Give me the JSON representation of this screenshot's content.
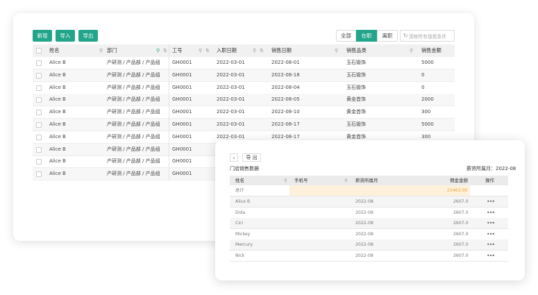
{
  "toolbar": {
    "add_label": "新增",
    "import_label": "导入",
    "export_label": "导出",
    "filter_all": "全部",
    "filter_active": "在职",
    "filter_left": "离职",
    "clear_search": "清除所有搜索条件"
  },
  "table": {
    "columns": [
      "姓名",
      "部门",
      "工号",
      "入职日期",
      "销售日期",
      "销售品类",
      "销售金额"
    ],
    "rows": [
      {
        "name": "Alice B",
        "dept": "产研测 / 产品部 / 产品组",
        "id": "GH0001",
        "join": "2022-03-01",
        "sale_date": "2022-08-01",
        "category": "玉石锻饰",
        "amount": "5000"
      },
      {
        "name": "Alice B",
        "dept": "产研测 / 产品部 / 产品组",
        "id": "GH0001",
        "join": "2022-03-01",
        "sale_date": "2022-08-18",
        "category": "玉石锻饰",
        "amount": "0"
      },
      {
        "name": "Alice B",
        "dept": "产研测 / 产品部 / 产品组",
        "id": "GH0001",
        "join": "2022-03-01",
        "sale_date": "2022-08-04",
        "category": "玉石锻饰",
        "amount": "0"
      },
      {
        "name": "Alice B",
        "dept": "产研测 / 产品部 / 产品组",
        "id": "GH0001",
        "join": "2022-03-01",
        "sale_date": "2022-08-05",
        "category": "黄金首饰",
        "amount": "2000"
      },
      {
        "name": "Alice B",
        "dept": "产研测 / 产品部 / 产品组",
        "id": "GH0001",
        "join": "2022-03-01",
        "sale_date": "2022-08-10",
        "category": "黄金首饰",
        "amount": "300"
      },
      {
        "name": "Alice B",
        "dept": "产研测 / 产品部 / 产品组",
        "id": "GH0001",
        "join": "2022-03-01",
        "sale_date": "2022-08-17",
        "category": "玉石锻饰",
        "amount": "5000"
      },
      {
        "name": "Alice B",
        "dept": "产研测 / 产品部 / 产品组",
        "id": "GH0001",
        "join": "2022-03-01",
        "sale_date": "2022-08-17",
        "category": "黄金首饰",
        "amount": "300"
      },
      {
        "name": "Alice B",
        "dept": "产研测 / 产品部 / 产品组",
        "id": "GH0001"
      },
      {
        "name": "Alice B",
        "dept": "产研测 / 产品部 / 产品组",
        "id": "GH0001"
      },
      {
        "name": "Alice B",
        "dept": "产研测 / 产品部 / 产品组",
        "id": "GH0001"
      }
    ]
  },
  "popup": {
    "export_label": "导 出",
    "title": "门店销售数据",
    "period": "薪资所属月：2022-08",
    "columns": [
      "姓名",
      "手机号",
      "薪资所属月",
      "佣金金额",
      "操作"
    ],
    "summary_label": "总计",
    "summary_amount": "23463.00",
    "rows": [
      {
        "name": "Alice B",
        "month": "2022-08",
        "amount": "2607.0"
      },
      {
        "name": "Dida",
        "month": "2022-08",
        "amount": "2607.0"
      },
      {
        "name": "Cici",
        "month": "2022-08",
        "amount": "2607.0"
      },
      {
        "name": "Mickey",
        "month": "2022-08",
        "amount": "2607.0"
      },
      {
        "name": "Mercury",
        "month": "2022-08",
        "amount": "2607.0"
      },
      {
        "name": "Nick",
        "month": "2022-08",
        "amount": "2607.0"
      }
    ]
  },
  "colors": {
    "accent": "#22a58a",
    "summary_bg": "#fdf1dc",
    "summary_text": "#e8a43a"
  }
}
